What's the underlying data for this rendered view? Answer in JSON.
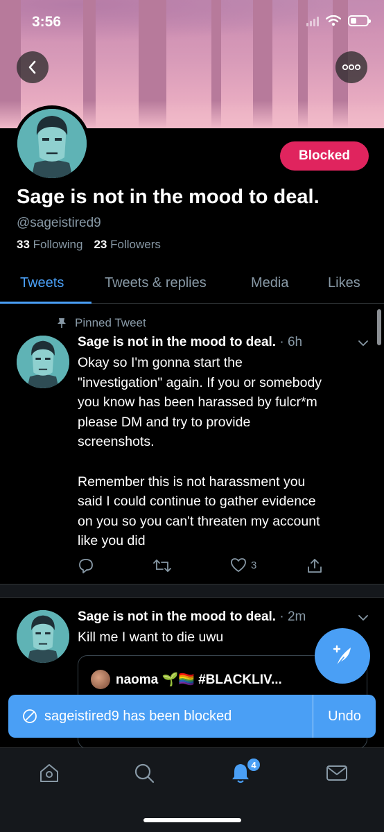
{
  "status_bar": {
    "time": "3:56"
  },
  "profile": {
    "name": "Sage is not in the mood to deal.",
    "handle": "@sageistired9",
    "following_count": "33",
    "following_label": "Following",
    "followers_count": "23",
    "followers_label": "Followers",
    "blocked_label": "Blocked"
  },
  "tabs": [
    {
      "label": "Tweets",
      "active": true
    },
    {
      "label": "Tweets & replies"
    },
    {
      "label": "Media"
    },
    {
      "label": "Likes"
    }
  ],
  "tweets": [
    {
      "pinned_label": "Pinned Tweet",
      "author": "Sage is not in the mood to deal.",
      "time": "· 6h",
      "body_lines": [
        "Okay so I'm gonna start the",
        "\"investigation\" again. If you or somebody",
        "you know has been harassed by fulcr*m",
        "please DM and try to provide",
        "screenshots.",
        "",
        "Remember this is not harassment you",
        "said I could continue to gather evidence",
        "on you so you can't threaten my account",
        "like you did"
      ],
      "like_count": "3"
    },
    {
      "author": "Sage is not in the mood to deal.",
      "time": "· 2m",
      "body": "Kill me I want to die uwu",
      "quote_author": "naoma 🌱🏳️‍🌈 #BLACKLIV..."
    }
  ],
  "toast": {
    "message": "sageistired9 has been blocked",
    "action": "Undo"
  },
  "bottom_nav": {
    "notification_badge": "4"
  },
  "colors": {
    "accent": "#4a9ff5",
    "blocked": "#e0245e",
    "muted": "#8899a6"
  }
}
